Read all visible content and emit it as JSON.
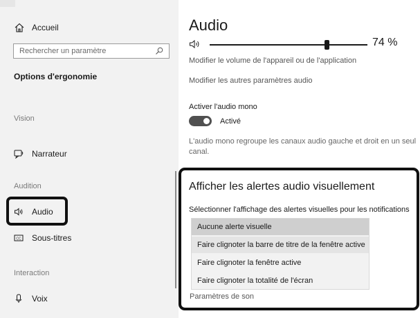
{
  "sidebar": {
    "home_label": "Accueil",
    "search_placeholder": "Rechercher un paramètre",
    "section_title": "Options d'ergonomie",
    "groups": {
      "vision": "Vision",
      "audition": "Audition",
      "interaction": "Interaction"
    },
    "items": {
      "narrator": "Narrateur",
      "audio": "Audio",
      "subtitles": "Sous-titres",
      "voice": "Voix"
    },
    "active_item": "Audio"
  },
  "main": {
    "title": "Audio",
    "volume_value": "74 %",
    "volume_percent": 74,
    "volume_desc": "Modifier le volume de l'appareil ou de l'application",
    "other_settings": "Modifier les autres paramètres audio",
    "mono_label": "Activer l'audio mono",
    "mono_state": "Activé",
    "mono_desc": "L'audio mono regroupe les canaux audio gauche et droit en un seul canal.",
    "alerts": {
      "title": "Afficher les alertes audio visuellement",
      "subtitle": "Sélectionner l'affichage des alertes visuelles pour les notifications",
      "options": [
        "Aucune alerte visuelle",
        "Faire clignoter la barre de titre de la fenêtre active",
        "Faire clignoter la fenêtre active",
        "Faire clignoter la totalité de l'écran"
      ],
      "selected_index": 0,
      "hover_index": 1
    },
    "sound_settings_link": "Paramètres de son"
  },
  "colors": {
    "sidebar_bg": "#f2f2f2",
    "toggle_on": "#505050",
    "highlight_border": "#111111"
  }
}
